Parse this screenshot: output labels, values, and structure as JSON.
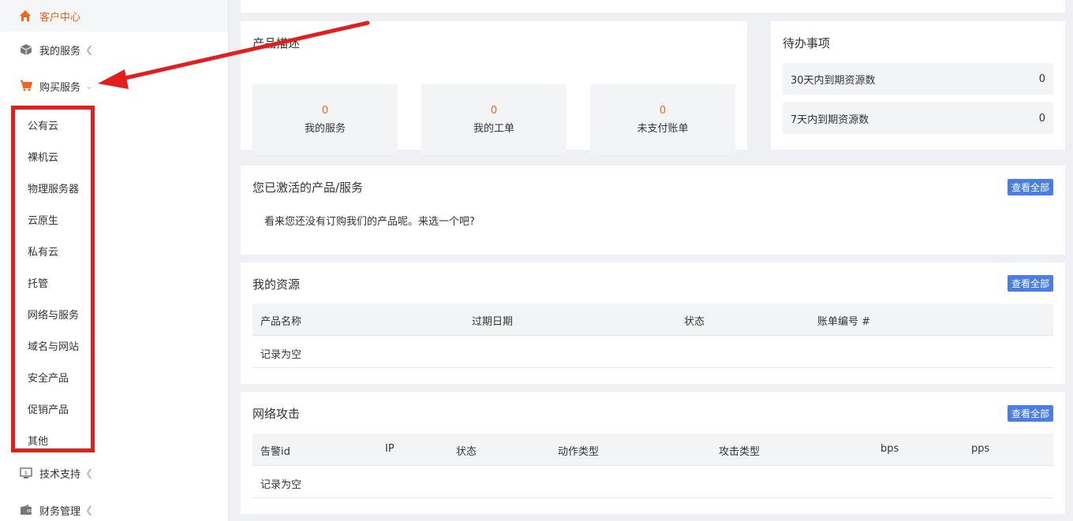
{
  "sidebar": {
    "top": {
      "label": "客户中心",
      "icon": "home-icon"
    },
    "items": [
      {
        "label": "我的服务",
        "icon": "box-icon"
      },
      {
        "label": "购买服务",
        "icon": "cart-icon"
      }
    ],
    "sub_items": [
      "公有云",
      "裸机云",
      "物理服务器",
      "云原生",
      "私有云",
      "托管",
      "网络与服务",
      "域名与网站",
      "安全产品",
      "促销产品",
      "其他"
    ],
    "bottom_items": [
      {
        "label": "技术支持",
        "icon": "monitor-icon"
      },
      {
        "label": "财务管理",
        "icon": "wallet-icon"
      }
    ]
  },
  "product_desc": {
    "title": "产品描述",
    "stats": [
      {
        "value": "0",
        "label": "我的服务"
      },
      {
        "value": "0",
        "label": "我的工单"
      },
      {
        "value": "0",
        "label": "未支付账单"
      }
    ]
  },
  "todo": {
    "title": "待办事项",
    "rows": [
      {
        "label": "30天内到期资源数",
        "value": "0"
      },
      {
        "label": "7天内到期资源数",
        "value": "0"
      }
    ]
  },
  "activated": {
    "title": "您已激活的产品/服务",
    "view_all": "查看全部",
    "empty_text": "看来您还没有订购我们的产品呢。来选一个吧?"
  },
  "resources": {
    "title": "我的资源",
    "view_all": "查看全部",
    "columns": [
      "产品名称",
      "过期日期",
      "状态",
      "账单编号 #"
    ],
    "empty_text": "记录为空"
  },
  "attacks": {
    "title": "网络攻击",
    "view_all": "查看全部",
    "columns": [
      "告警id",
      "IP",
      "状态",
      "动作类型",
      "攻击类型",
      "bps",
      "pps"
    ],
    "empty_text": "记录为空"
  },
  "colors": {
    "accent": "#f26522",
    "button": "#4a7fdf",
    "highlight": "#e31e1e"
  }
}
